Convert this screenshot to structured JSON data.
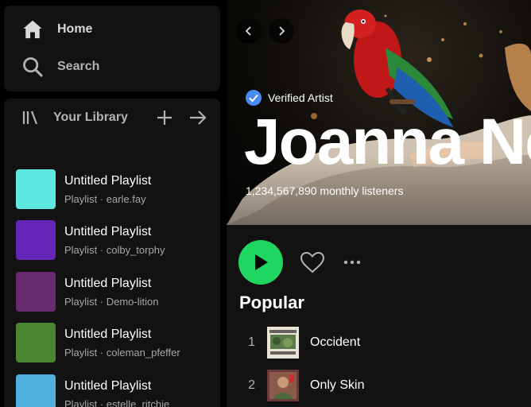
{
  "nav": {
    "home_label": "Home",
    "search_label": "Search"
  },
  "library": {
    "title": "Your Library",
    "playlists": [
      {
        "name": "Untitled Playlist",
        "meta": "Playlist · earle.fay",
        "color": "#5ee9e0"
      },
      {
        "name": "Untitled Playlist",
        "meta": "Playlist · colby_torphy",
        "color": "#6525b6"
      },
      {
        "name": "Untitled Playlist",
        "meta": "Playlist · Demo-lition",
        "color": "#6a2a70"
      },
      {
        "name": "Untitled Playlist",
        "meta": "Playlist · coleman_pfeffer",
        "color": "#4a8530"
      },
      {
        "name": "Untitled Playlist",
        "meta": "Playlist · estelle_ritchie",
        "color": "#4fb0e0"
      }
    ]
  },
  "artist": {
    "verified_label": "Verified Artist",
    "name": "Joanna Newsom",
    "monthly_listeners": "1,234,567,890 monthly listeners"
  },
  "popular": {
    "title": "Popular",
    "tracks": [
      {
        "number": "1",
        "title": "Occident"
      },
      {
        "number": "2",
        "title": "Only Skin"
      }
    ]
  },
  "colors": {
    "accent": "#1ed760",
    "panel_bg": "#121212",
    "app_bg": "#000000",
    "verified_badge": "#4a8af4"
  },
  "icons": {
    "home": "home-icon",
    "search": "search-icon",
    "library": "library-icon",
    "add": "plus-icon",
    "expand": "arrow-right-icon",
    "back": "chevron-left-icon",
    "forward": "chevron-right-icon",
    "verified": "verified-check-icon",
    "play": "play-icon",
    "follow": "heart-icon",
    "more": "more-dots-icon"
  }
}
